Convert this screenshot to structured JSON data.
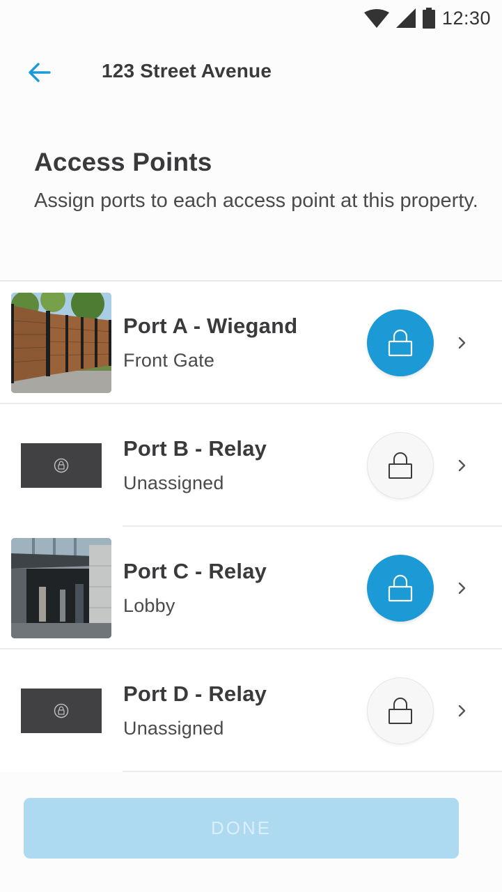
{
  "status_bar": {
    "time": "12:30",
    "icons": [
      "wifi-icon",
      "cellular-signal-icon",
      "battery-icon"
    ]
  },
  "app_bar": {
    "back_icon": "back-arrow-icon",
    "title": "123 Street Avenue"
  },
  "section": {
    "title": "Access Points",
    "description": "Assign ports to each access point at this property."
  },
  "ports": [
    {
      "title": "Port A - Wiegand",
      "subtitle": "Front Gate",
      "image": "fence-gate-photo",
      "lock_state": "active"
    },
    {
      "title": "Port B - Relay",
      "subtitle": "Unassigned",
      "image": "placeholder-lock",
      "lock_state": "inactive"
    },
    {
      "title": "Port C - Relay",
      "subtitle": "Lobby",
      "image": "lobby-entrance-photo",
      "lock_state": "active"
    },
    {
      "title": "Port D - Relay",
      "subtitle": "Unassigned",
      "image": "placeholder-lock",
      "lock_state": "inactive"
    }
  ],
  "done_button": {
    "label": "DONE",
    "enabled": false
  },
  "colors": {
    "accent": "#1b9ad6",
    "button_disabled": "#add9f1",
    "text_primary": "#3a3a3c",
    "placeholder_bg": "#414042"
  }
}
